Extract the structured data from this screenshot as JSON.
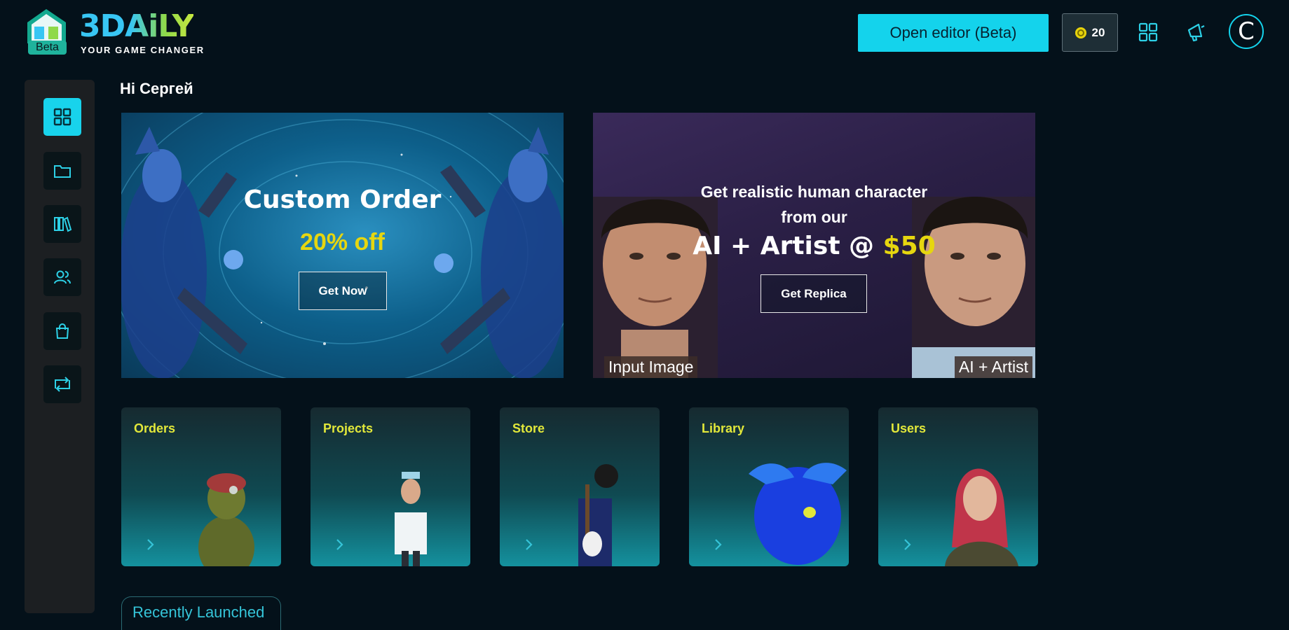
{
  "header": {
    "logo_text": "3DAiLY",
    "logo_badge": "Beta",
    "logo_tagline": "YOUR GAME CHANGER",
    "editor_button": "Open editor (Beta)",
    "credits": "20",
    "avatar_letter": "C"
  },
  "greeting": "Hi Сергей",
  "banners": {
    "custom_order": {
      "title": "Custom Order",
      "discount": "20% off",
      "button": "Get Now"
    },
    "replica": {
      "line1": "Get realistic human character",
      "line2": "from our",
      "line3_prefix": "AI + Artist @ ",
      "line3_price": "$50",
      "button": "Get Replica",
      "caption_left": "Input Image",
      "caption_right": "AI + Artist"
    }
  },
  "cards": [
    {
      "title": "Orders"
    },
    {
      "title": "Projects"
    },
    {
      "title": "Store"
    },
    {
      "title": "Library"
    },
    {
      "title": "Users"
    }
  ],
  "recent": {
    "label": "Recently Launched"
  },
  "colors": {
    "accent": "#14d3ec",
    "card_title": "#e2e83a",
    "discount": "#e6d60f",
    "background": "#04111a"
  },
  "icons": {
    "sidebar": [
      "dashboard-grid-icon",
      "folder-icon",
      "library-books-icon",
      "users-icon",
      "shopping-bag-icon",
      "swap-icon"
    ],
    "header": [
      "coin-icon",
      "apps-grid-icon",
      "megaphone-icon"
    ]
  }
}
